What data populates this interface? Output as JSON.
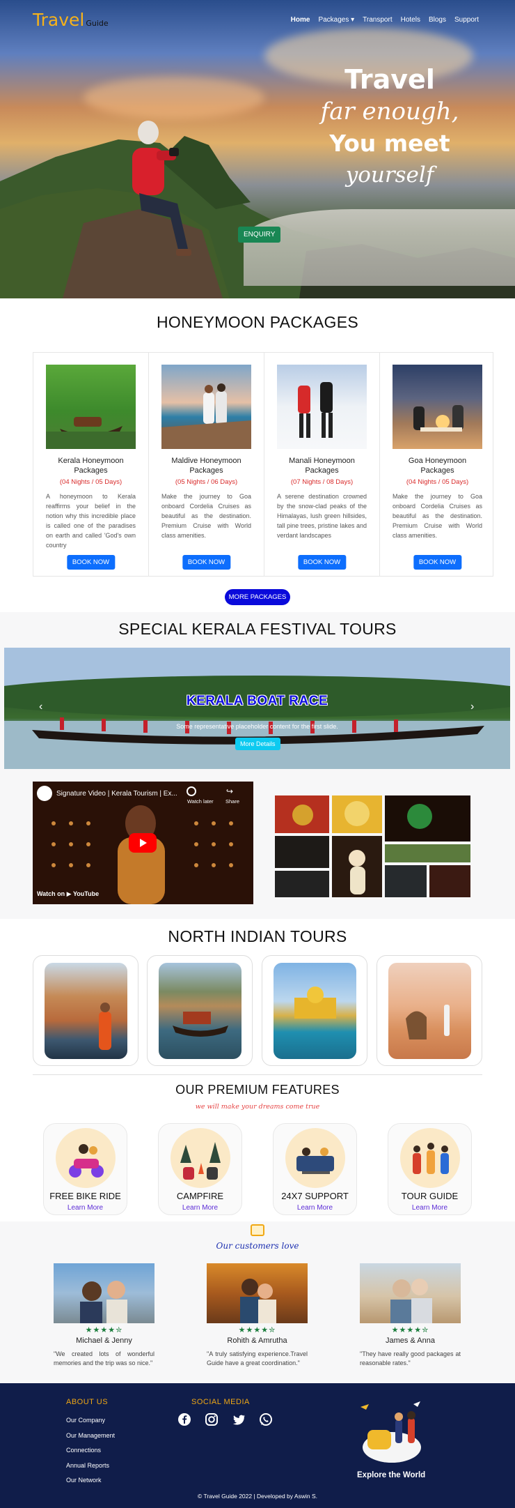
{
  "nav": {
    "logo": "Travel",
    "logo_small": "Guide",
    "links": [
      {
        "label": "Home"
      },
      {
        "label": "Packages ▾"
      },
      {
        "label": "Transport"
      },
      {
        "label": "Hotels"
      },
      {
        "label": "Blogs"
      },
      {
        "label": "Support"
      }
    ]
  },
  "hero": {
    "line1": "Travel",
    "line2": "far enough,",
    "line3": "You meet",
    "line4": "yourself",
    "enquiry": "ENQUIRY"
  },
  "honeymoon": {
    "title": "HONEYMOON PACKAGES",
    "packages": [
      {
        "title": "Kerala Honeymoon Packages",
        "nights": "(04 Nights / 05 Days)",
        "desc": "A honeymoon to Kerala reaffirms your belief in the notion why this incredible place is called one of the paradises on earth and called 'God's own country",
        "button": "BOOK NOW"
      },
      {
        "title": "Maldive Honeymoon Packages",
        "nights": "(05 Nights / 06 Days)",
        "desc": "Make the journey to Goa onboard Cordelia Cruises as beautiful as the destination. Premium Cruise with World class amenities.",
        "button": "BOOK NOW"
      },
      {
        "title": "Manali Honeymoon Packages",
        "nights": "(07 Nights / 08 Days)",
        "desc": "A serene destination crowned by the snow-clad peaks of the Himalayas, lush green hillsides, tall pine trees, pristine lakes and verdant landscapes",
        "button": "BOOK NOW"
      },
      {
        "title": "Goa Honeymoon Packages",
        "nights": "(04 Nights / 05 Days)",
        "desc": "Make the journey to Goa onboard Cordelia Cruises as beautiful as the destination. Premium Cruise with World class amenities.",
        "button": "BOOK NOW"
      }
    ],
    "more": "MORE PACKAGES"
  },
  "kerala": {
    "title": "SPECIAL KERALA FESTIVAL TOURS",
    "slide_title": "KERALA BOAT RACE",
    "slide_sub": "Some representative placeholder content for the first slide.",
    "slide_button": "More Details",
    "video_title": "Signature Video | Kerala Tourism | Ex...",
    "video_watch_later": "Watch later",
    "video_share": "Share",
    "video_watch_on": "Watch on",
    "video_youtube": "YouTube"
  },
  "north": {
    "title": "NORTH INDIAN TOURS"
  },
  "features": {
    "title": "OUR PREMIUM FEATURES",
    "subtitle": "we will make your dreams come true",
    "items": [
      {
        "name": "FREE BIKE RIDE",
        "link": "Learn More"
      },
      {
        "name": "CAMPFIRE",
        "link": "Learn More"
      },
      {
        "name": "24X7 SUPPORT",
        "link": "Learn More"
      },
      {
        "name": "TOUR GUIDE",
        "link": "Learn More"
      }
    ]
  },
  "testimonials": {
    "title": "Our customers love",
    "items": [
      {
        "stars": "★★★★✮",
        "name": "Michael & Jenny",
        "quote": "\"We created lots of wonderful memories and the trip was so nice.\""
      },
      {
        "stars": "★★★★✮",
        "name": "Rohith & Amrutha",
        "quote": "\"A truly satisfying experience.Travel Guide have a great coordination.\""
      },
      {
        "stars": "★★★★✮",
        "name": "James & Anna",
        "quote": "\"They have really good packages at reasonable rates.\""
      }
    ]
  },
  "footer": {
    "about_title": "ABOUT US",
    "links": [
      "Our Company",
      "Our Management",
      "Connections",
      "Annual Reports",
      "Our Network"
    ],
    "social_title": "SOCIAL MEDIA",
    "explore": "Explore the World",
    "copyright": "© Travel Guide 2022 | Developed by Aswin S."
  }
}
